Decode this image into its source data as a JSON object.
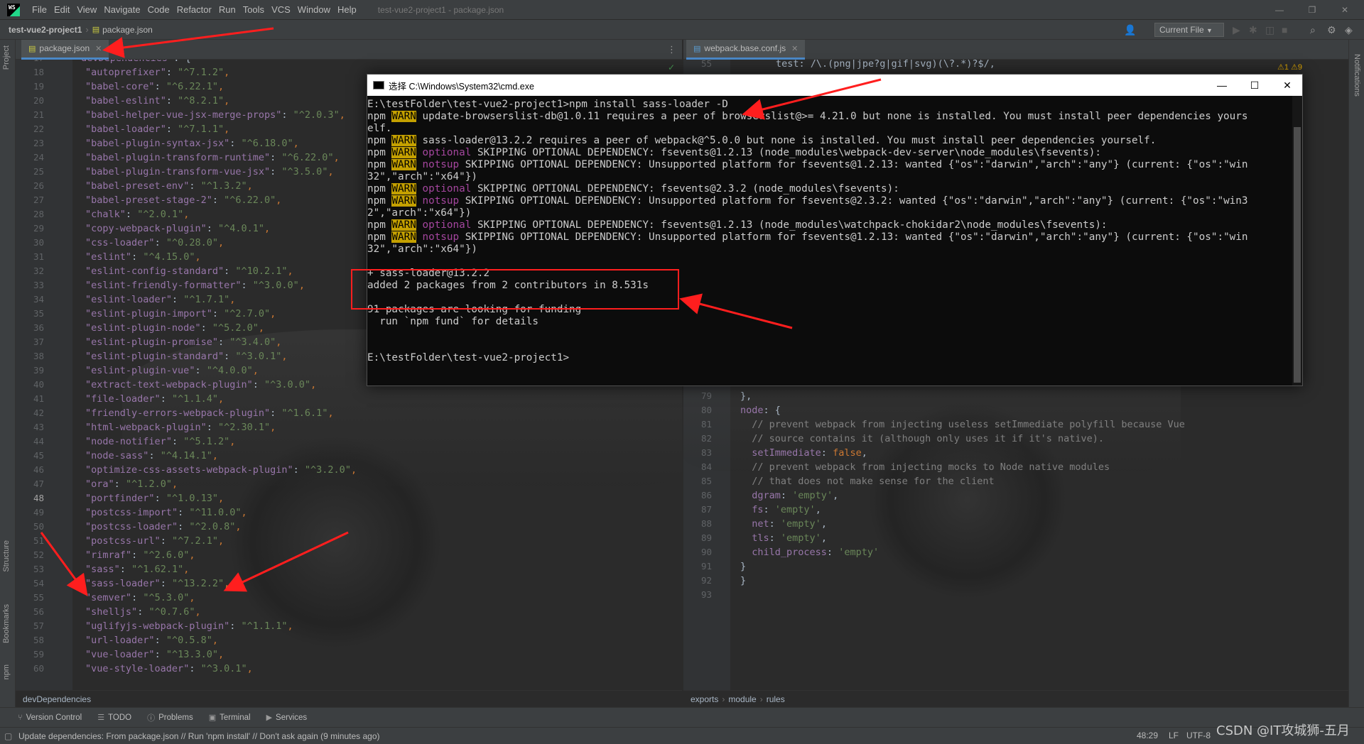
{
  "menubar": {
    "logo": "WS",
    "items": [
      "File",
      "Edit",
      "View",
      "Navigate",
      "Code",
      "Refactor",
      "Run",
      "Tools",
      "VCS",
      "Window",
      "Help"
    ],
    "window_title": "test-vue2-project1 - package.json"
  },
  "navbar": {
    "project": "test-vue2-project1",
    "file": "package.json",
    "run_config": "Current File"
  },
  "left_stripe": {
    "project": "Project",
    "structure": "Structure",
    "bookmarks": "Bookmarks",
    "npm": "npm"
  },
  "right_stripe": {
    "notifications": "Notifications"
  },
  "left_editor": {
    "tab": "package.json",
    "inspection": "✓",
    "lines": [
      {
        "n": "17",
        "key": "devDependencies",
        "val": null
      },
      {
        "n": "18",
        "key": "autoprefixer",
        "val": "^7.1.2"
      },
      {
        "n": "19",
        "key": "babel-core",
        "val": "^6.22.1"
      },
      {
        "n": "20",
        "key": "babel-eslint",
        "val": "^8.2.1"
      },
      {
        "n": "21",
        "key": "babel-helper-vue-jsx-merge-props",
        "val": "^2.0.3"
      },
      {
        "n": "22",
        "key": "babel-loader",
        "val": "^7.1.1"
      },
      {
        "n": "23",
        "key": "babel-plugin-syntax-jsx",
        "val": "^6.18.0"
      },
      {
        "n": "24",
        "key": "babel-plugin-transform-runtime",
        "val": "^6.22.0"
      },
      {
        "n": "25",
        "key": "babel-plugin-transform-vue-jsx",
        "val": "^3.5.0"
      },
      {
        "n": "26",
        "key": "babel-preset-env",
        "val": "^1.3.2"
      },
      {
        "n": "27",
        "key": "babel-preset-stage-2",
        "val": "^6.22.0"
      },
      {
        "n": "28",
        "key": "chalk",
        "val": "^2.0.1"
      },
      {
        "n": "29",
        "key": "copy-webpack-plugin",
        "val": "^4.0.1"
      },
      {
        "n": "30",
        "key": "css-loader",
        "val": "^0.28.0"
      },
      {
        "n": "31",
        "key": "eslint",
        "val": "^4.15.0"
      },
      {
        "n": "32",
        "key": "eslint-config-standard",
        "val": "^10.2.1"
      },
      {
        "n": "33",
        "key": "eslint-friendly-formatter",
        "val": "^3.0.0"
      },
      {
        "n": "34",
        "key": "eslint-loader",
        "val": "^1.7.1"
      },
      {
        "n": "35",
        "key": "eslint-plugin-import",
        "val": "^2.7.0"
      },
      {
        "n": "36",
        "key": "eslint-plugin-node",
        "val": "^5.2.0"
      },
      {
        "n": "37",
        "key": "eslint-plugin-promise",
        "val": "^3.4.0"
      },
      {
        "n": "38",
        "key": "eslint-plugin-standard",
        "val": "^3.0.1"
      },
      {
        "n": "39",
        "key": "eslint-plugin-vue",
        "val": "^4.0.0"
      },
      {
        "n": "40",
        "key": "extract-text-webpack-plugin",
        "val": "^3.0.0"
      },
      {
        "n": "41",
        "key": "file-loader",
        "val": "^1.1.4"
      },
      {
        "n": "42",
        "key": "friendly-errors-webpack-plugin",
        "val": "^1.6.1"
      },
      {
        "n": "43",
        "key": "html-webpack-plugin",
        "val": "^2.30.1"
      },
      {
        "n": "44",
        "key": "node-notifier",
        "val": "^5.1.2"
      },
      {
        "n": "45",
        "key": "node-sass",
        "val": "^4.14.1"
      },
      {
        "n": "46",
        "key": "optimize-css-assets-webpack-plugin",
        "val": "^3.2.0"
      },
      {
        "n": "47",
        "key": "ora",
        "val": "^1.2.0"
      },
      {
        "n": "48",
        "key": "portfinder",
        "val": "^1.0.13"
      },
      {
        "n": "49",
        "key": "postcss-import",
        "val": "^11.0.0"
      },
      {
        "n": "50",
        "key": "postcss-loader",
        "val": "^2.0.8"
      },
      {
        "n": "51",
        "key": "postcss-url",
        "val": "^7.2.1"
      },
      {
        "n": "52",
        "key": "rimraf",
        "val": "^2.6.0"
      },
      {
        "n": "53",
        "key": "sass",
        "val": "^1.62.1"
      },
      {
        "n": "54",
        "key": "sass-loader",
        "val": "^13.2.2"
      },
      {
        "n": "55",
        "key": "semver",
        "val": "^5.3.0"
      },
      {
        "n": "56",
        "key": "shelljs",
        "val": "^0.7.6"
      },
      {
        "n": "57",
        "key": "uglifyjs-webpack-plugin",
        "val": "^1.1.1"
      },
      {
        "n": "58",
        "key": "url-loader",
        "val": "^0.5.8"
      },
      {
        "n": "59",
        "key": "vue-loader",
        "val": "^13.3.0"
      },
      {
        "n": "60",
        "key": "vue-style-loader",
        "val": "^3.0.1"
      }
    ],
    "breadcrumb": "devDependencies"
  },
  "right_editor": {
    "tab": "webpack.base.conf.js",
    "inspection": "⚠1 ⚠9",
    "line55": {
      "n": "55",
      "text": "test: /\\.(png|jpe?g|gif|svg)(\\?.*)?$/,"
    },
    "lines": [
      {
        "n": "78",
        "html": "<span class='t'>  ]</span>"
      },
      {
        "n": "79",
        "html": "<span class='t'>},</span>"
      },
      {
        "n": "80",
        "html": "<span class='k'>node</span><span class='t'>: {</span>"
      },
      {
        "n": "81",
        "html": "<span class='c'>  // prevent webpack from injecting useless setImmediate polyfill because Vue</span>"
      },
      {
        "n": "82",
        "html": "<span class='c'>  // source contains it (although only uses it if it's native).</span>"
      },
      {
        "n": "83",
        "html": "<span class='k'>  setImmediate</span><span class='t'>: </span><span class='p'>false</span><span class='t'>,</span>"
      },
      {
        "n": "84",
        "html": "<span class='c'>  // prevent webpack from injecting mocks to Node native modules</span>"
      },
      {
        "n": "85",
        "html": "<span class='c'>  // that does not make sense for the client</span>"
      },
      {
        "n": "86",
        "html": "<span class='k'>  dgram</span><span class='t'>: </span><span class='s'>'empty'</span><span class='t'>,</span>"
      },
      {
        "n": "87",
        "html": "<span class='k'>  fs</span><span class='t'>: </span><span class='s'>'empty'</span><span class='t'>,</span>"
      },
      {
        "n": "88",
        "html": "<span class='k'>  net</span><span class='t'>: </span><span class='s'>'empty'</span><span class='t'>,</span>"
      },
      {
        "n": "89",
        "html": "<span class='k'>  tls</span><span class='t'>: </span><span class='s'>'empty'</span><span class='t'>,</span>"
      },
      {
        "n": "90",
        "html": "<span class='k'>  child_process</span><span class='t'>: </span><span class='s'>'empty'</span>"
      },
      {
        "n": "91",
        "html": "<span class='t'>}</span>"
      },
      {
        "n": "92",
        "html": "<span class='t'>}</span>"
      },
      {
        "n": "93",
        "html": ""
      }
    ],
    "breadcrumbs": [
      "exports",
      "module",
      "rules"
    ]
  },
  "cmd": {
    "title": "选择 C:\\Windows\\System32\\cmd.exe",
    "lines": [
      {
        "text": "E:\\testFolder\\test-vue2-project1>npm install sass-loader -D"
      },
      {
        "prefix": "npm ",
        "tag": "WARN",
        "kind": "warn",
        "text": " update-browserslist-db@1.0.11 requires a peer of browserslist@>= 4.21.0 but none is installed. You must install peer dependencies yours"
      },
      {
        "text": "elf."
      },
      {
        "prefix": "npm ",
        "tag": "WARN",
        "kind": "warn",
        "text": " sass-loader@13.2.2 requires a peer of webpack@^5.0.0 but none is installed. You must install peer dependencies yourself."
      },
      {
        "prefix": "npm ",
        "tag": "WARN",
        "kind": "warn",
        "tag2": "optional",
        "text": " SKIPPING OPTIONAL DEPENDENCY: fsevents@1.2.13 (node_modules\\webpack-dev-server\\node_modules\\fsevents):"
      },
      {
        "prefix": "npm ",
        "tag": "WARN",
        "kind": "warn",
        "tag2": "notsup",
        "text": " SKIPPING OPTIONAL DEPENDENCY: Unsupported platform for fsevents@1.2.13: wanted {\"os\":\"darwin\",\"arch\":\"any\"} (current: {\"os\":\"win"
      },
      {
        "text": "32\",\"arch\":\"x64\"})"
      },
      {
        "prefix": "npm ",
        "tag": "WARN",
        "kind": "warn",
        "tag2": "optional",
        "text": " SKIPPING OPTIONAL DEPENDENCY: fsevents@2.3.2 (node_modules\\fsevents):"
      },
      {
        "prefix": "npm ",
        "tag": "WARN",
        "kind": "warn",
        "tag2": "notsup",
        "text": " SKIPPING OPTIONAL DEPENDENCY: Unsupported platform for fsevents@2.3.2: wanted {\"os\":\"darwin\",\"arch\":\"any\"} (current: {\"os\":\"win3"
      },
      {
        "text": "2\",\"arch\":\"x64\"})"
      },
      {
        "prefix": "npm ",
        "tag": "WARN",
        "kind": "warn",
        "tag2": "optional",
        "text": " SKIPPING OPTIONAL DEPENDENCY: fsevents@1.2.13 (node_modules\\watchpack-chokidar2\\node_modules\\fsevents):"
      },
      {
        "prefix": "npm ",
        "tag": "WARN",
        "kind": "warn",
        "tag2": "notsup",
        "text": " SKIPPING OPTIONAL DEPENDENCY: Unsupported platform for fsevents@1.2.13: wanted {\"os\":\"darwin\",\"arch\":\"any\"} (current: {\"os\":\"win"
      },
      {
        "text": "32\",\"arch\":\"x64\"})"
      },
      {
        "text": ""
      },
      {
        "text": "+ sass-loader@13.2.2"
      },
      {
        "text": "added 2 packages from 2 contributors in 8.531s"
      },
      {
        "text": ""
      },
      {
        "text": "91 packages are looking for funding"
      },
      {
        "text": "  run `npm fund` for details"
      },
      {
        "text": ""
      },
      {
        "text": ""
      },
      {
        "text": "E:\\testFolder\\test-vue2-project1>"
      }
    ]
  },
  "toolwindows": [
    {
      "icon": "⑂",
      "label": "Version Control"
    },
    {
      "icon": "☰",
      "label": "TODO"
    },
    {
      "icon": "ⓘ",
      "label": "Problems"
    },
    {
      "icon": "▣",
      "label": "Terminal"
    },
    {
      "icon": "▶",
      "label": "Services"
    }
  ],
  "status": {
    "message": "Update dependencies: From package.json // Run 'npm install' // Don't ask again (9 minutes ago)",
    "position": "48:29",
    "line_sep": "LF",
    "encoding": "UTF-8"
  },
  "watermark": "CSDN @IT攻城狮-五月",
  "colors": {
    "warn_bg": "#c4a000",
    "annotation": "#ff1e1e",
    "string": "#6a8759",
    "key": "#9876aa"
  }
}
